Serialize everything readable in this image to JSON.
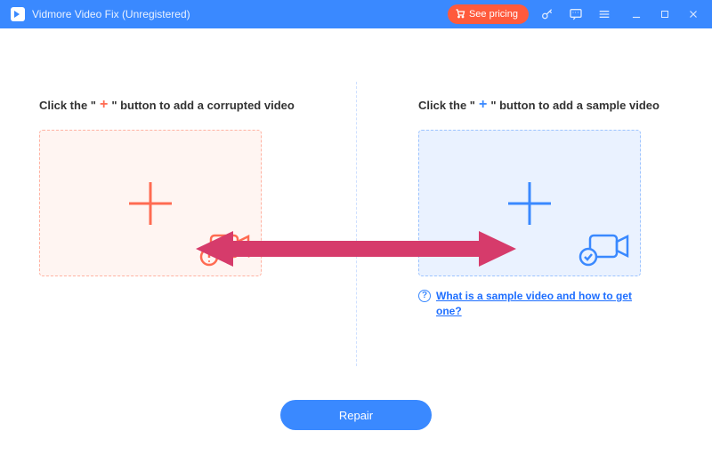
{
  "titlebar": {
    "title": "Vidmore Video Fix (Unregistered)",
    "pricing_label": "See pricing"
  },
  "left": {
    "instr_prefix": "Click the \"",
    "instr_plus": "+",
    "instr_suffix": "\" button to add a corrupted video"
  },
  "right": {
    "instr_prefix": "Click the \"",
    "instr_plus": "+",
    "instr_suffix": "\" button to add a sample video"
  },
  "help": {
    "mark": "?",
    "text": "What is a sample video and how to get one?"
  },
  "actions": {
    "repair_label": "Repair"
  }
}
